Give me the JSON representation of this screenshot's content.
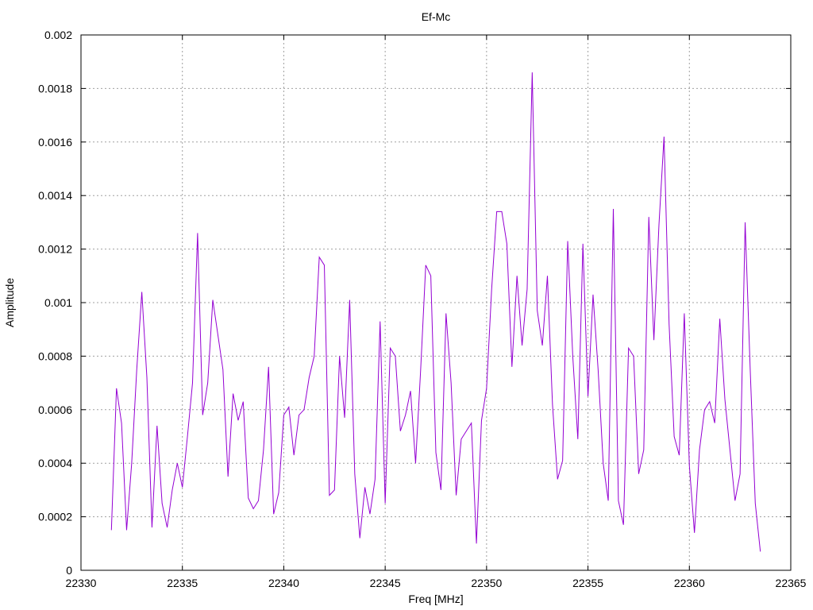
{
  "chart_data": {
    "type": "line",
    "title": "Ef-Mc",
    "xlabel": "Freq [MHz]",
    "ylabel": "Amplitude",
    "xlim": [
      22330,
      22365
    ],
    "ylim": [
      0,
      0.002
    ],
    "xticks": [
      22330,
      22335,
      22340,
      22345,
      22350,
      22355,
      22360,
      22365
    ],
    "xtick_labels": [
      "22330",
      "22335",
      "22340",
      "22345",
      "22350",
      "22355",
      "22360",
      "22365"
    ],
    "yticks": [
      0,
      0.0002,
      0.0004,
      0.0006,
      0.0008,
      0.001,
      0.0012,
      0.0014,
      0.0016,
      0.0018,
      0.002
    ],
    "ytick_labels": [
      "0",
      "0.0002",
      "0.0004",
      "0.0006",
      "0.0008",
      "0.001",
      "0.0012",
      "0.0014",
      "0.0016",
      "0.0018",
      "0.002"
    ],
    "grid": true,
    "line_color": "#9400d3",
    "series": [
      {
        "x": [
          22331.5,
          22331.75,
          22332.0,
          22332.25,
          22332.5,
          22332.75,
          22333.0,
          22333.25,
          22333.5,
          22333.75,
          22334.0,
          22334.25,
          22334.5,
          22334.75,
          22335.0,
          22335.25,
          22335.5,
          22335.75,
          22336.0,
          22336.25,
          22336.5,
          22336.75,
          22337.0,
          22337.25,
          22337.5,
          22337.75,
          22338.0,
          22338.25,
          22338.5,
          22338.75,
          22339.0,
          22339.25,
          22339.5,
          22339.75,
          22340.0,
          22340.25,
          22340.5,
          22340.75,
          22341.0,
          22341.25,
          22341.5,
          22341.75,
          22342.0,
          22342.25,
          22342.5,
          22342.75,
          22343.0,
          22343.25,
          22343.5,
          22343.75,
          22344.0,
          22344.25,
          22344.5,
          22344.75,
          22345.0,
          22345.25,
          22345.5,
          22345.75,
          22346.0,
          22346.25,
          22346.5,
          22346.75,
          22347.0,
          22347.25,
          22347.5,
          22347.75,
          22348.0,
          22348.25,
          22348.5,
          22348.75,
          22349.0,
          22349.25,
          22349.5,
          22349.75,
          22350.0,
          22350.25,
          22350.5,
          22350.75,
          22351.0,
          22351.25,
          22351.5,
          22351.75,
          22352.0,
          22352.25,
          22352.5,
          22352.75,
          22353.0,
          22353.25,
          22353.5,
          22353.75,
          22354.0,
          22354.25,
          22354.5,
          22354.75,
          22355.0,
          22355.25,
          22355.5,
          22355.75,
          22356.0,
          22356.25,
          22356.5,
          22356.75,
          22357.0,
          22357.25,
          22357.5,
          22357.75,
          22358.0,
          22358.25,
          22358.5,
          22358.75,
          22359.0,
          22359.25,
          22359.5,
          22359.75,
          22360.0,
          22360.25,
          22360.5,
          22360.75,
          22361.0,
          22361.25,
          22361.5,
          22361.75,
          22362.0,
          22362.25,
          22362.5,
          22362.75,
          22363.0,
          22363.25,
          22363.5
        ],
        "y": [
          0.00015,
          0.00068,
          0.00055,
          0.00015,
          0.0004,
          0.00075,
          0.00104,
          0.00072,
          0.00016,
          0.00054,
          0.00025,
          0.00016,
          0.0003,
          0.0004,
          0.00031,
          0.0005,
          0.0007,
          0.00126,
          0.00058,
          0.0007,
          0.00101,
          0.00088,
          0.00075,
          0.00035,
          0.00066,
          0.00056,
          0.00063,
          0.00027,
          0.00023,
          0.00026,
          0.00045,
          0.00076,
          0.00021,
          0.00029,
          0.00058,
          0.00061,
          0.00043,
          0.00058,
          0.0006,
          0.00072,
          0.0008,
          0.00117,
          0.00114,
          0.00028,
          0.0003,
          0.0008,
          0.00057,
          0.00101,
          0.00036,
          0.00012,
          0.00031,
          0.00021,
          0.00034,
          0.00093,
          0.00025,
          0.00083,
          0.0008,
          0.00052,
          0.00058,
          0.00067,
          0.0004,
          0.00075,
          0.00114,
          0.0011,
          0.00044,
          0.0003,
          0.00096,
          0.0007,
          0.00028,
          0.00049,
          0.00052,
          0.00055,
          0.0001,
          0.00056,
          0.00068,
          0.00105,
          0.00134,
          0.00134,
          0.00122,
          0.00076,
          0.0011,
          0.00084,
          0.00105,
          0.00186,
          0.00097,
          0.00084,
          0.0011,
          0.00062,
          0.00034,
          0.00041,
          0.00123,
          0.0008,
          0.00049,
          0.00122,
          0.00065,
          0.00103,
          0.00075,
          0.0004,
          0.00026,
          0.00135,
          0.00026,
          0.00017,
          0.00083,
          0.0008,
          0.00036,
          0.00045,
          0.00132,
          0.00086,
          0.00129,
          0.00162,
          0.00092,
          0.0005,
          0.00043,
          0.00096,
          0.00039,
          0.00014,
          0.00045,
          0.0006,
          0.00063,
          0.00055,
          0.00094,
          0.00064,
          0.00045,
          0.00026,
          0.00036,
          0.0013,
          0.00075,
          0.00025,
          7e-05
        ]
      }
    ]
  }
}
